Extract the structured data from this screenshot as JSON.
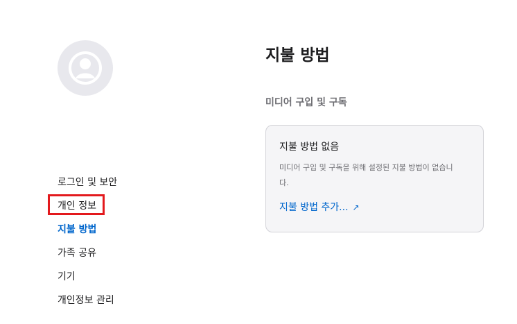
{
  "sidebar": {
    "avatar_icon": "user-circle-icon",
    "items": [
      {
        "label": "로그인 및 보안"
      },
      {
        "label": "개인 정보"
      },
      {
        "label": "지불 방법"
      },
      {
        "label": "가족 공유"
      },
      {
        "label": "기기"
      },
      {
        "label": "개인정보 관리"
      }
    ],
    "active_index": 2,
    "highlighted_index": 1
  },
  "main": {
    "title": "지불 방법",
    "section_title": "미디어 구입 및 구독",
    "card": {
      "title": "지불 방법 없음",
      "description": "미디어 구입 및 구독을 위해 설정된 지불 방법이 없습니다.",
      "link_label": "지불 방법 추가...",
      "link_icon": "↗"
    }
  },
  "colors": {
    "accent": "#0066cc",
    "highlight_box": "#e3191d",
    "card_background": "#f5f5f7",
    "avatar_background": "#e8e8ed"
  }
}
